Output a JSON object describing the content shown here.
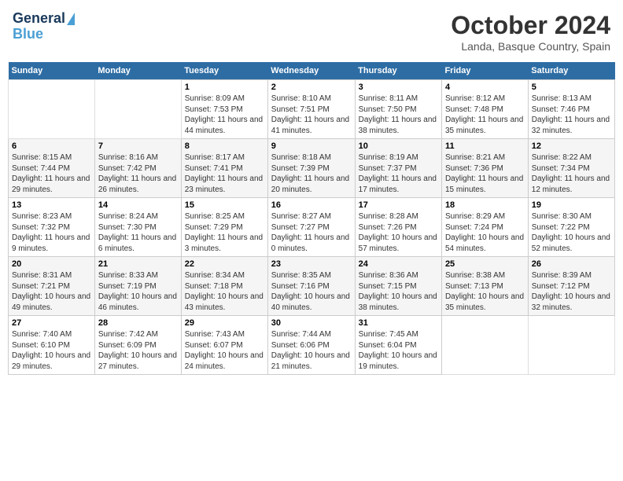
{
  "header": {
    "logo_line1": "General",
    "logo_line2": "Blue",
    "title": "October 2024",
    "location": "Landa, Basque Country, Spain"
  },
  "days_of_week": [
    "Sunday",
    "Monday",
    "Tuesday",
    "Wednesday",
    "Thursday",
    "Friday",
    "Saturday"
  ],
  "weeks": [
    [
      {
        "day": "",
        "info": ""
      },
      {
        "day": "",
        "info": ""
      },
      {
        "day": "1",
        "info": "Sunrise: 8:09 AM\nSunset: 7:53 PM\nDaylight: 11 hours and 44 minutes."
      },
      {
        "day": "2",
        "info": "Sunrise: 8:10 AM\nSunset: 7:51 PM\nDaylight: 11 hours and 41 minutes."
      },
      {
        "day": "3",
        "info": "Sunrise: 8:11 AM\nSunset: 7:50 PM\nDaylight: 11 hours and 38 minutes."
      },
      {
        "day": "4",
        "info": "Sunrise: 8:12 AM\nSunset: 7:48 PM\nDaylight: 11 hours and 35 minutes."
      },
      {
        "day": "5",
        "info": "Sunrise: 8:13 AM\nSunset: 7:46 PM\nDaylight: 11 hours and 32 minutes."
      }
    ],
    [
      {
        "day": "6",
        "info": "Sunrise: 8:15 AM\nSunset: 7:44 PM\nDaylight: 11 hours and 29 minutes."
      },
      {
        "day": "7",
        "info": "Sunrise: 8:16 AM\nSunset: 7:42 PM\nDaylight: 11 hours and 26 minutes."
      },
      {
        "day": "8",
        "info": "Sunrise: 8:17 AM\nSunset: 7:41 PM\nDaylight: 11 hours and 23 minutes."
      },
      {
        "day": "9",
        "info": "Sunrise: 8:18 AM\nSunset: 7:39 PM\nDaylight: 11 hours and 20 minutes."
      },
      {
        "day": "10",
        "info": "Sunrise: 8:19 AM\nSunset: 7:37 PM\nDaylight: 11 hours and 17 minutes."
      },
      {
        "day": "11",
        "info": "Sunrise: 8:21 AM\nSunset: 7:36 PM\nDaylight: 11 hours and 15 minutes."
      },
      {
        "day": "12",
        "info": "Sunrise: 8:22 AM\nSunset: 7:34 PM\nDaylight: 11 hours and 12 minutes."
      }
    ],
    [
      {
        "day": "13",
        "info": "Sunrise: 8:23 AM\nSunset: 7:32 PM\nDaylight: 11 hours and 9 minutes."
      },
      {
        "day": "14",
        "info": "Sunrise: 8:24 AM\nSunset: 7:30 PM\nDaylight: 11 hours and 6 minutes."
      },
      {
        "day": "15",
        "info": "Sunrise: 8:25 AM\nSunset: 7:29 PM\nDaylight: 11 hours and 3 minutes."
      },
      {
        "day": "16",
        "info": "Sunrise: 8:27 AM\nSunset: 7:27 PM\nDaylight: 11 hours and 0 minutes."
      },
      {
        "day": "17",
        "info": "Sunrise: 8:28 AM\nSunset: 7:26 PM\nDaylight: 10 hours and 57 minutes."
      },
      {
        "day": "18",
        "info": "Sunrise: 8:29 AM\nSunset: 7:24 PM\nDaylight: 10 hours and 54 minutes."
      },
      {
        "day": "19",
        "info": "Sunrise: 8:30 AM\nSunset: 7:22 PM\nDaylight: 10 hours and 52 minutes."
      }
    ],
    [
      {
        "day": "20",
        "info": "Sunrise: 8:31 AM\nSunset: 7:21 PM\nDaylight: 10 hours and 49 minutes."
      },
      {
        "day": "21",
        "info": "Sunrise: 8:33 AM\nSunset: 7:19 PM\nDaylight: 10 hours and 46 minutes."
      },
      {
        "day": "22",
        "info": "Sunrise: 8:34 AM\nSunset: 7:18 PM\nDaylight: 10 hours and 43 minutes."
      },
      {
        "day": "23",
        "info": "Sunrise: 8:35 AM\nSunset: 7:16 PM\nDaylight: 10 hours and 40 minutes."
      },
      {
        "day": "24",
        "info": "Sunrise: 8:36 AM\nSunset: 7:15 PM\nDaylight: 10 hours and 38 minutes."
      },
      {
        "day": "25",
        "info": "Sunrise: 8:38 AM\nSunset: 7:13 PM\nDaylight: 10 hours and 35 minutes."
      },
      {
        "day": "26",
        "info": "Sunrise: 8:39 AM\nSunset: 7:12 PM\nDaylight: 10 hours and 32 minutes."
      }
    ],
    [
      {
        "day": "27",
        "info": "Sunrise: 7:40 AM\nSunset: 6:10 PM\nDaylight: 10 hours and 29 minutes."
      },
      {
        "day": "28",
        "info": "Sunrise: 7:42 AM\nSunset: 6:09 PM\nDaylight: 10 hours and 27 minutes."
      },
      {
        "day": "29",
        "info": "Sunrise: 7:43 AM\nSunset: 6:07 PM\nDaylight: 10 hours and 24 minutes."
      },
      {
        "day": "30",
        "info": "Sunrise: 7:44 AM\nSunset: 6:06 PM\nDaylight: 10 hours and 21 minutes."
      },
      {
        "day": "31",
        "info": "Sunrise: 7:45 AM\nSunset: 6:04 PM\nDaylight: 10 hours and 19 minutes."
      },
      {
        "day": "",
        "info": ""
      },
      {
        "day": "",
        "info": ""
      }
    ]
  ]
}
